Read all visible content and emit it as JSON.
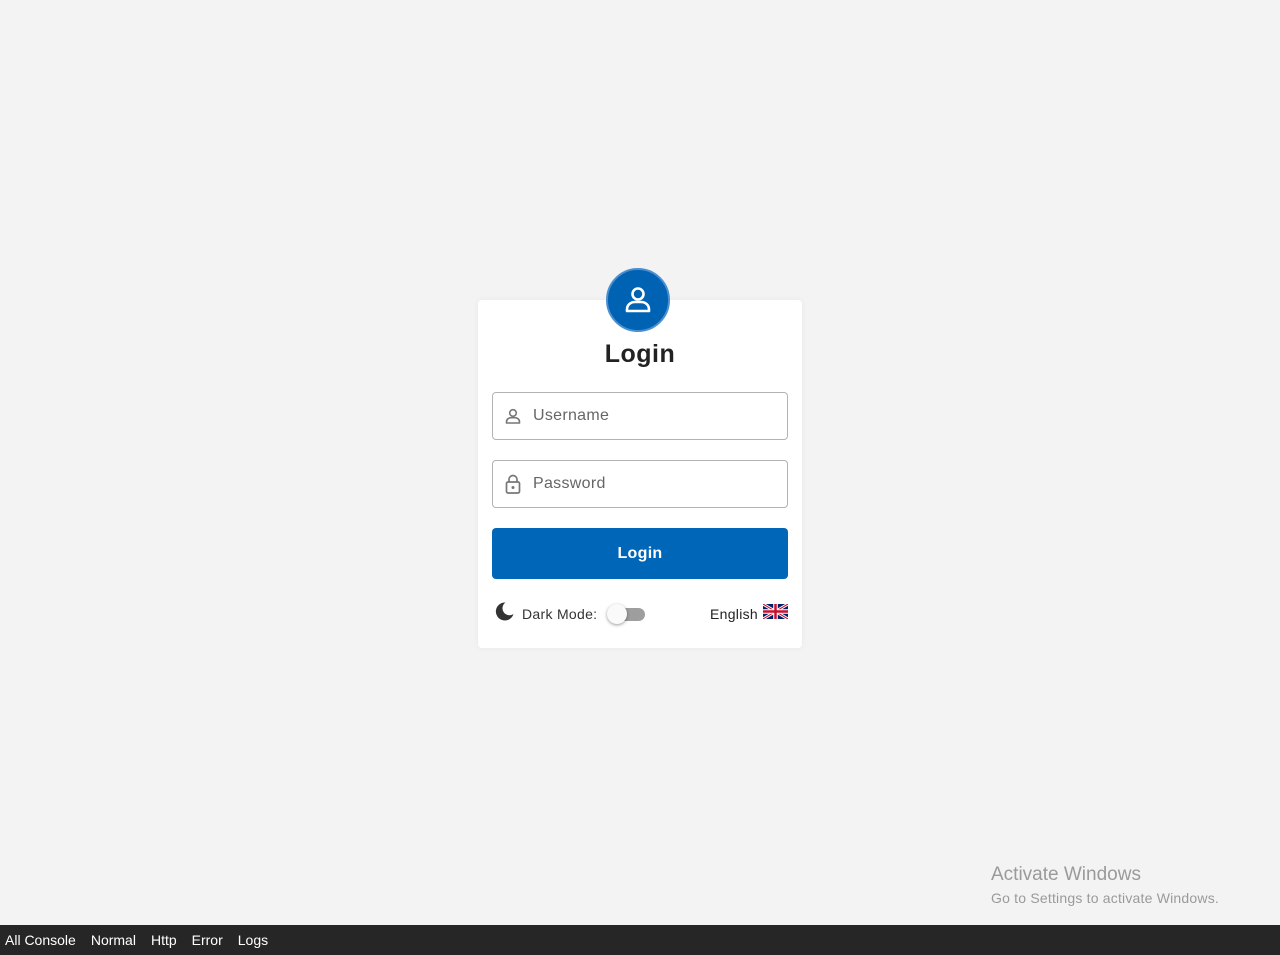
{
  "login": {
    "title": "Login",
    "username_placeholder": "Username",
    "password_placeholder": "Password",
    "submit_label": "Login",
    "dark_mode_label": "Dark Mode:",
    "dark_mode_enabled": false,
    "language_label": "English",
    "language_flag_icon": "uk-flag-icon",
    "avatar_icon": "user-icon"
  },
  "colors": {
    "primary": "#0066b8",
    "background": "#f3f3f3",
    "console_bar": "#262626"
  },
  "watermark": {
    "line1": "Activate Windows",
    "line2": "Go to Settings to activate Windows."
  },
  "console": {
    "tabs": [
      "All Console",
      "Normal",
      "Http",
      "Error",
      "Logs"
    ]
  }
}
